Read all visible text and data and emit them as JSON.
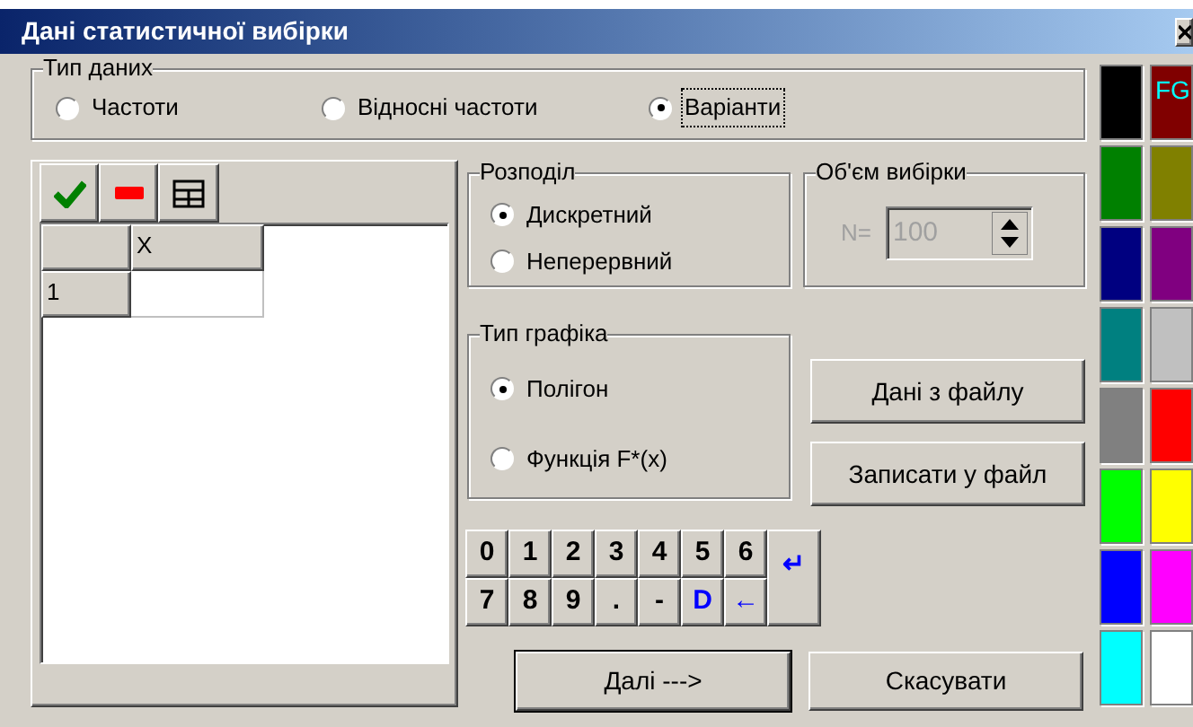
{
  "window": {
    "title": "Дані статистичної вибірки"
  },
  "data_type": {
    "label": "Тип даних",
    "options": [
      {
        "label": "Частоти",
        "selected": false,
        "focused": false
      },
      {
        "label": "Відносні частоти",
        "selected": false,
        "focused": false
      },
      {
        "label": "Варіанти",
        "selected": true,
        "focused": true
      }
    ]
  },
  "grid": {
    "columns": [
      "X"
    ],
    "rows": [
      "1"
    ]
  },
  "distribution": {
    "label": "Розподіл",
    "options": [
      {
        "label": "Дискретний",
        "selected": true
      },
      {
        "label": "Неперервний",
        "selected": false
      }
    ]
  },
  "sample_size": {
    "label": "Об'єм вибірки",
    "prefix": "N=",
    "value": "100",
    "disabled": true
  },
  "chart_type": {
    "label": "Тип графіка",
    "options": [
      {
        "label": "Полігон",
        "selected": true
      },
      {
        "label": "Функція F*(x)",
        "selected": false
      }
    ]
  },
  "file_buttons": [
    "Дані з файлу",
    "Записати у файл"
  ],
  "keypad": [
    {
      "label": "0",
      "kind": "digit"
    },
    {
      "label": "1",
      "kind": "digit"
    },
    {
      "label": "2",
      "kind": "digit"
    },
    {
      "label": "3",
      "kind": "digit"
    },
    {
      "label": "4",
      "kind": "digit"
    },
    {
      "label": "5",
      "kind": "digit"
    },
    {
      "label": "6",
      "kind": "digit"
    },
    {
      "label": "↵",
      "kind": "enter"
    },
    {
      "label": "7",
      "kind": "digit"
    },
    {
      "label": "8",
      "kind": "digit"
    },
    {
      "label": "9",
      "kind": "digit"
    },
    {
      "label": ".",
      "kind": "digit"
    },
    {
      "label": "-",
      "kind": "digit"
    },
    {
      "label": "D",
      "kind": "action"
    },
    {
      "label": "←",
      "kind": "action"
    }
  ],
  "footer_buttons": [
    {
      "label": "Далі --->",
      "default": true
    },
    {
      "label": "Скасувати",
      "default": false
    }
  ],
  "palette": [
    {
      "color": "#000000"
    },
    {
      "color": "#800000",
      "label": "FG"
    },
    {
      "color": "#008000"
    },
    {
      "color": "#808000"
    },
    {
      "color": "#000080"
    },
    {
      "color": "#800080"
    },
    {
      "color": "#008080"
    },
    {
      "color": "#c0c0c0"
    },
    {
      "color": "#808080"
    },
    {
      "color": "#ff0000"
    },
    {
      "color": "#00ff00"
    },
    {
      "color": "#ffff00"
    },
    {
      "color": "#0000ff"
    },
    {
      "color": "#ff00ff"
    },
    {
      "color": "#00ffff"
    },
    {
      "color": "#ffffff"
    }
  ]
}
